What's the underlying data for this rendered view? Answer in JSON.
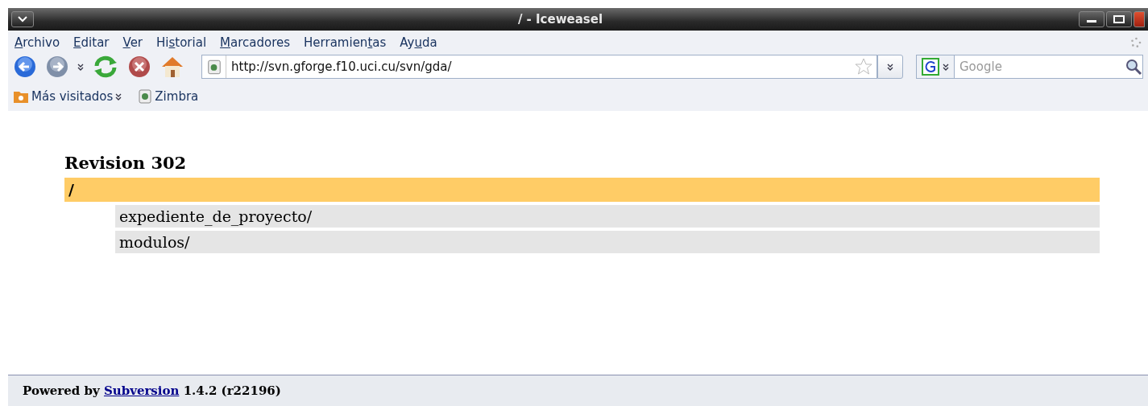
{
  "window": {
    "title": "/ - Iceweasel"
  },
  "menu": [
    {
      "key": "A",
      "after": "rchivo"
    },
    {
      "key": "E",
      "after": "ditar"
    },
    {
      "key": "V",
      "after": "er"
    },
    {
      "before": "Hi",
      "key": "s",
      "after": "torial"
    },
    {
      "key": "M",
      "after": "arcadores"
    },
    {
      "before": "Herramien",
      "key": "t",
      "after": "as"
    },
    {
      "before": "Ay",
      "key": "u",
      "after": "da"
    }
  ],
  "address": {
    "value": "http://svn.gforge.f10.uci.cu/svn/gda/"
  },
  "search": {
    "placeholder": "Google"
  },
  "bookmarks": [
    {
      "label": "Más visitados",
      "kind": "folder"
    },
    {
      "label": "Zimbra",
      "kind": "page"
    }
  ],
  "page": {
    "heading": "Revision 302",
    "path": "/",
    "entries": [
      "expediente_de_proyecto/",
      "modulos/"
    ]
  },
  "footer": {
    "before": "Powered by",
    "link": "Subversion",
    "after": "1.4.2 (r22196)"
  }
}
